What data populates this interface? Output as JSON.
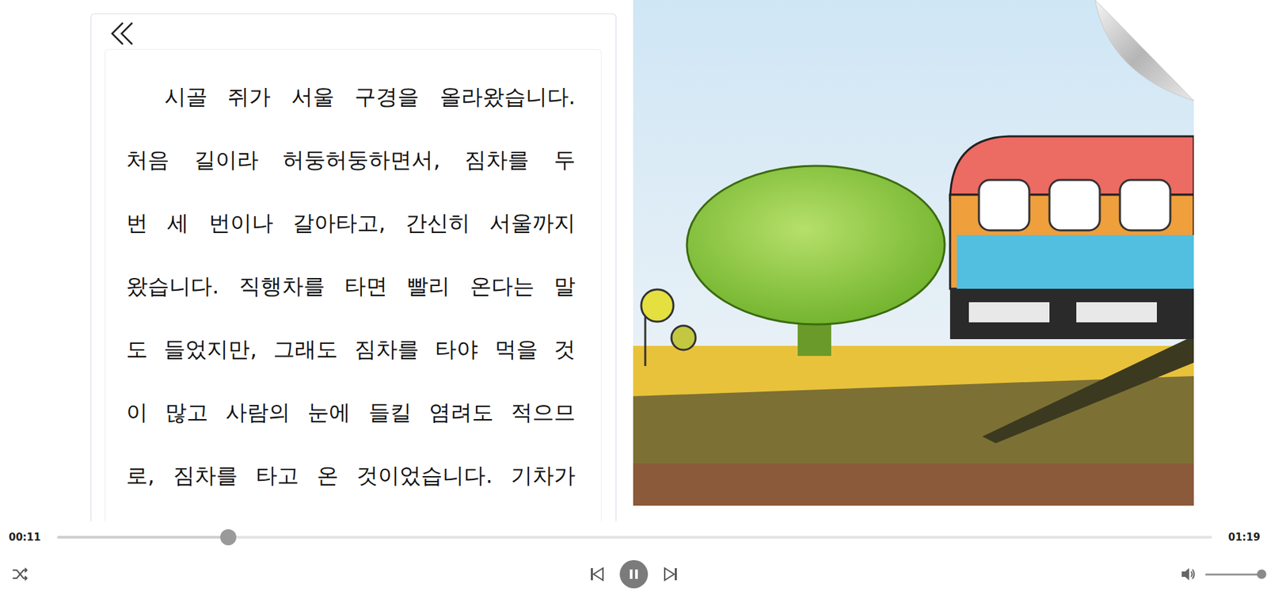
{
  "story": {
    "lines": [
      "시골 쥐가 서울 구경을 올라왔습니다.",
      "처음 길이라 허둥허둥하면서, 짐차를 두",
      "번 세 번이나 갈아타고, 간신히 서울까지",
      "왔습니다. 직행차를 타면 빨리 온다는 말",
      "도 들었지만, 그래도 짐차를 타야 먹을 것",
      "이 많고 사람의 눈에 들킬 염려도 적으므",
      "로, 짐차를 타고 온 것이었습니다. 기차가"
    ]
  },
  "player": {
    "elapsed": "00:11",
    "duration": "01:19",
    "progress": {
      "level": 0.148
    },
    "playing": true,
    "volume": {
      "level": 1.0
    }
  }
}
